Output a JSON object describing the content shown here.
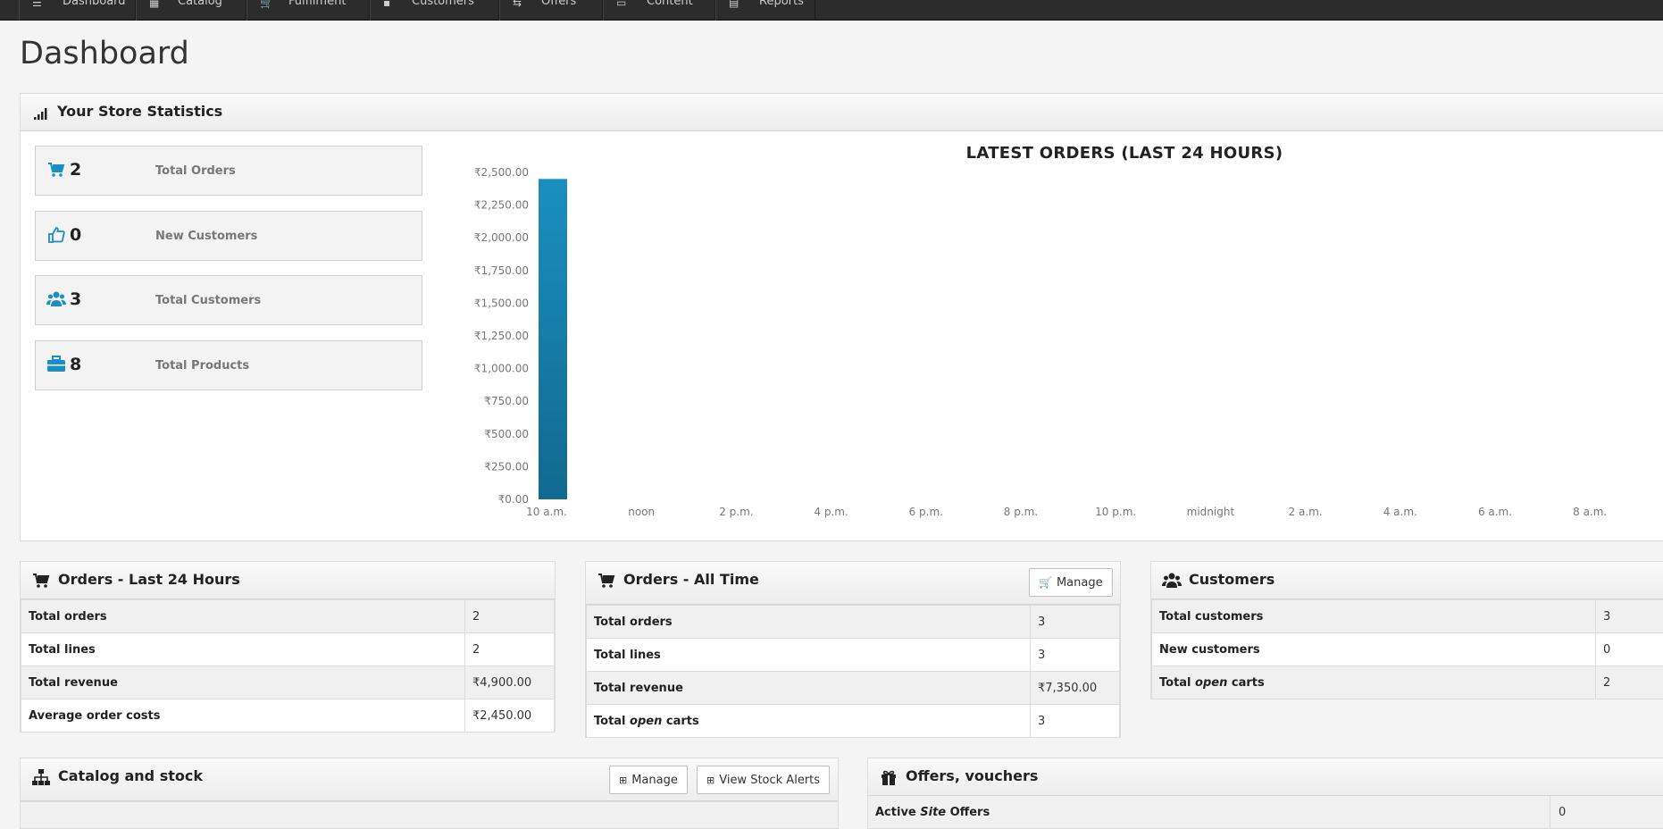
{
  "nav": {
    "items": [
      {
        "label": "Dashboard",
        "icon": "list-icon"
      },
      {
        "label": "Catalog",
        "icon": "catalog-icon"
      },
      {
        "label": "Fulfilment",
        "icon": "cart-icon"
      },
      {
        "label": "Customers",
        "icon": "user-icon"
      },
      {
        "label": "Offers",
        "icon": "offers-icon"
      },
      {
        "label": "Content",
        "icon": "content-icon"
      },
      {
        "label": "Reports",
        "icon": "reports-icon"
      }
    ]
  },
  "page": {
    "title": "Dashboard"
  },
  "stats": {
    "title": "Your Store Statistics",
    "boxes": [
      {
        "value": "2",
        "label": "Total Orders",
        "icon": "cart-icon"
      },
      {
        "value": "0",
        "label": "New Customers",
        "icon": "thumbs-up-icon"
      },
      {
        "value": "3",
        "label": "Total Customers",
        "icon": "users-icon"
      },
      {
        "value": "8",
        "label": "Total Products",
        "icon": "briefcase-icon"
      }
    ]
  },
  "chart_data": {
    "type": "bar",
    "title": "LATEST ORDERS (LAST 24 HOURS)",
    "xlabel": "",
    "ylabel": "",
    "x_ticks": [
      "10 a.m.",
      "noon",
      "2 p.m.",
      "4 p.m.",
      "6 p.m.",
      "8 p.m.",
      "10 p.m.",
      "midnight",
      "2 a.m.",
      "4 a.m.",
      "6 a.m.",
      "8 a.m."
    ],
    "y_ticks": [
      "₹0.00",
      "₹250.00",
      "₹500.00",
      "₹750.00",
      "₹1,000.00",
      "₹1,250.00",
      "₹1,500.00",
      "₹1,750.00",
      "₹2,000.00",
      "₹2,250.00",
      "₹2,500.00"
    ],
    "ylim": [
      0,
      2500
    ],
    "categories": [
      "10 a.m."
    ],
    "values": [
      2450
    ],
    "bar_color": "#1a8fc0",
    "grid": false
  },
  "orders24": {
    "title": "Orders - Last 24 Hours",
    "rows": [
      {
        "k": "Total orders",
        "v": "2"
      },
      {
        "k": "Total lines",
        "v": "2"
      },
      {
        "k": "Total revenue",
        "v": "₹4,900.00"
      },
      {
        "k": "Average order costs",
        "v": "₹2,450.00"
      }
    ]
  },
  "ordersAll": {
    "title": "Orders - All Time",
    "manage": "Manage",
    "rows": [
      {
        "k": "Total orders",
        "v": "3"
      },
      {
        "k": "Total lines",
        "v": "3"
      },
      {
        "k": "Total revenue",
        "v": "₹7,350.00"
      },
      {
        "k_pre": "Total",
        "k_em": "open",
        "k_post": "carts",
        "v": "3"
      }
    ]
  },
  "customers": {
    "title": "Customers",
    "rows": [
      {
        "k": "Total customers",
        "v": "3"
      },
      {
        "k": "New customers",
        "v": "0"
      },
      {
        "k_pre": "Total",
        "k_em": "open",
        "k_post": "carts",
        "v": "2"
      }
    ]
  },
  "catalog": {
    "title": "Catalog and stock",
    "manage": "Manage",
    "stock_alerts": "View Stock Alerts"
  },
  "offers": {
    "title": "Offers, vouchers",
    "row_pre": "Active",
    "row_em": "Site",
    "row_post": "Offers",
    "row_val": "0"
  }
}
